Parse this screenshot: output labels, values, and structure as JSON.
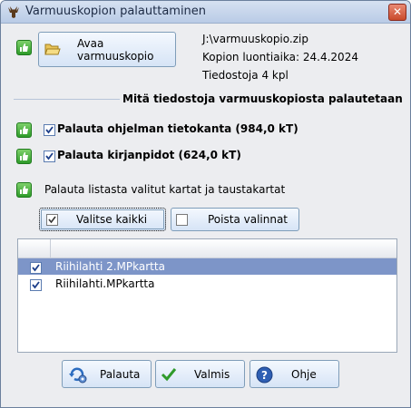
{
  "window": {
    "title": "Varmuuskopion palauttaminen"
  },
  "open_button": {
    "label": "Avaa varmuuskopio"
  },
  "backup_info": {
    "path": "J:\\varmuuskopio.zip",
    "created": "Kopion luontiaika: 24.4.2024",
    "files": "Tiedostoja 4 kpl"
  },
  "section": {
    "title": "Mitä tiedostoja varmuuskopiosta palautetaan"
  },
  "options": {
    "database": {
      "label": "Palauta ohjelman tietokanta (984,0 kT)",
      "checked": true
    },
    "ledgers": {
      "label": "Palauta kirjanpidot (624,0 kT)",
      "checked": true
    },
    "maps_info": "Palauta listasta valitut kartat ja taustakartat"
  },
  "select_all_button": {
    "label": "Valitse kaikki"
  },
  "clear_selection_button": {
    "label": "Poista valinnat"
  },
  "map_list": {
    "items": [
      {
        "name": "Riihilahti 2.MPkartta",
        "checked": true,
        "selected": true
      },
      {
        "name": "Riihilahti.MPkartta",
        "checked": true,
        "selected": false
      }
    ]
  },
  "footer": {
    "restore_label": "Palauta",
    "done_label": "Valmis",
    "help_label": "Ohje"
  }
}
